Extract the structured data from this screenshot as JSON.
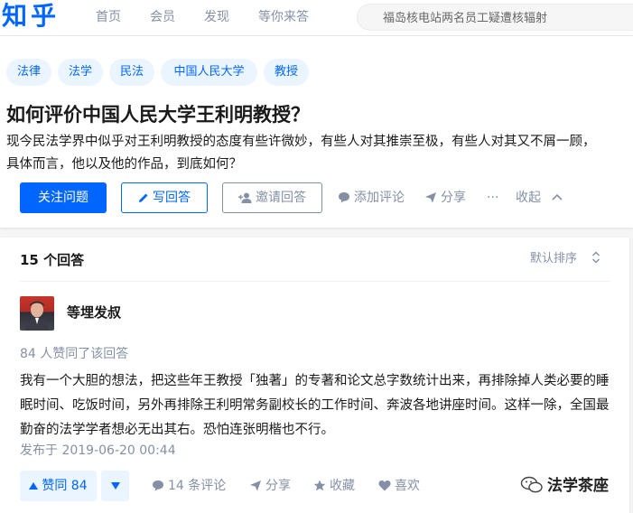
{
  "header": {
    "logo": "知乎",
    "nav": [
      "首页",
      "会员",
      "发现",
      "等你来答"
    ],
    "search_placeholder": "福岛核电站两名员工疑遭核辐射"
  },
  "question": {
    "tags": [
      "法律",
      "法学",
      "民法",
      "中国人民大学",
      "教授"
    ],
    "title": "如何评价中国人民大学王利明教授？",
    "description": "现今民法学界中似乎对王利明教授的态度有些许微妙，有些人对其推崇至极，有些人对其又不屑一顾，具体而言，他以及他的作品，到底如何？",
    "actions": {
      "follow": "关注问题",
      "write": "写回答",
      "invite": "邀请回答",
      "comment": "添加评论",
      "share": "分享",
      "more": "···",
      "collapse": "收起"
    }
  },
  "answers": {
    "count_label": "15 个回答",
    "sort_label": "默认排序",
    "item": {
      "author": "等埋发叔",
      "votes_text": "84 人赞同了该回答",
      "content": "我有一个大胆的想法，把这些年王教授「独著」的专著和论文总字数统计出来，再排除掉人类必要的睡眠时间、吃饭时间，另外再排除王利明常务副校长的工作时间、奔波各地讲座时间。这样一除，全国最勤奋的法学学者想必无出其右。恐怕连张明楷也不行。",
      "date": "发布于 2019-06-20 00:44",
      "upvote": "赞同 84",
      "comments": "14 条评论",
      "share": "分享",
      "favorite": "收藏",
      "like": "喜欢"
    }
  },
  "watermark": "法学茶座",
  "colors": {
    "brand_blue": "#0066ff",
    "tag_bg": "#ebf5ff",
    "muted": "#8590a6"
  }
}
